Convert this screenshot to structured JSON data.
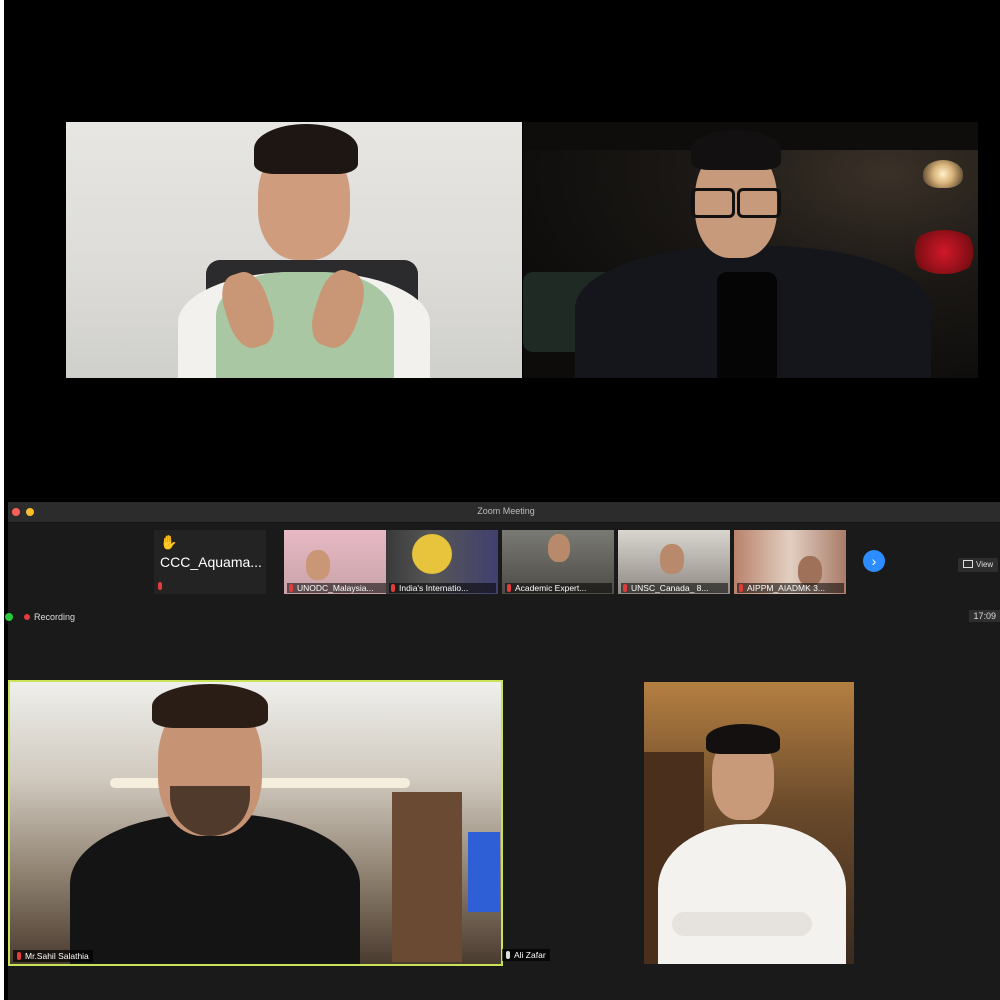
{
  "window": {
    "title": "Zoom Meeting",
    "traffic_colors": [
      "#ff5f57",
      "#febc2e"
    ],
    "view_label": "View",
    "recording_label": "Recording",
    "clock": "17:09",
    "next_icon": "chevron-right-icon"
  },
  "thumbnails": [
    {
      "label": "CCC_Aquama...",
      "raised_hand": true,
      "hand_icon": "✋"
    },
    {
      "label": "UNODC_Malaysia..."
    },
    {
      "label": "India's Internatio..."
    },
    {
      "label": "Academic Expert..."
    },
    {
      "label": "UNSC_Canada_ 8..."
    },
    {
      "label": "AIPPM_AIADMK 3..."
    }
  ],
  "gallery": [
    {
      "name": "Mr.Sahil Salathia",
      "active_speaker": true,
      "border_color": "#c8e25a"
    },
    {
      "name": "Ali Zafar"
    }
  ]
}
